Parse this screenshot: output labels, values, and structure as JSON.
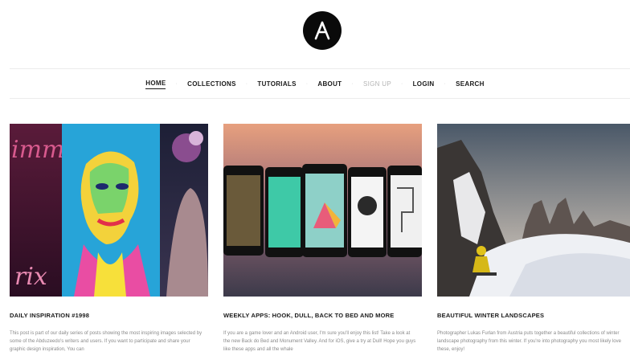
{
  "nav": {
    "items": [
      {
        "label": "HOME",
        "state": "active"
      },
      {
        "label": "COLLECTIONS",
        "state": "normal"
      },
      {
        "label": "TUTORIALS",
        "state": "normal"
      },
      {
        "label": "ABOUT",
        "state": "normal"
      },
      {
        "label": "SIGN UP",
        "state": "muted"
      },
      {
        "label": "LOGIN",
        "state": "normal"
      },
      {
        "label": "SEARCH",
        "state": "normal"
      }
    ],
    "separator": "·"
  },
  "posts": [
    {
      "title": "DAILY INSPIRATION #1998",
      "excerpt": "This post is part of our daily series of posts showing the most inspiring images selected by some of the Abduzeedo's writers and users. If you want to participate and share your graphic design inspiration, You can",
      "image_art": [
        "immy",
        "rix"
      ]
    },
    {
      "title": "WEEKLY APPS: HOOK, DULL, BACK TO BED AND MORE",
      "excerpt": "If you are a game lover and an Android user, I'm sure you'll enjoy this list! Take a look at the new Back do Bed and Monument Valley. And for iOS, give a try at Dull! Hope you guys like these apps and all the whale"
    },
    {
      "title": "BEAUTIFUL WINTER LANDSCAPES",
      "excerpt": "Photographer Lukas Furlan from Austria puts together a beautiful collections of winter landscape photography from this winter. If you're into photography you most likely love these, enjoy!"
    }
  ],
  "colors": {
    "logo_bg": "#0a0a0a",
    "accent_green": "#3ec9a7",
    "nav_muted": "#b5b5b5"
  }
}
